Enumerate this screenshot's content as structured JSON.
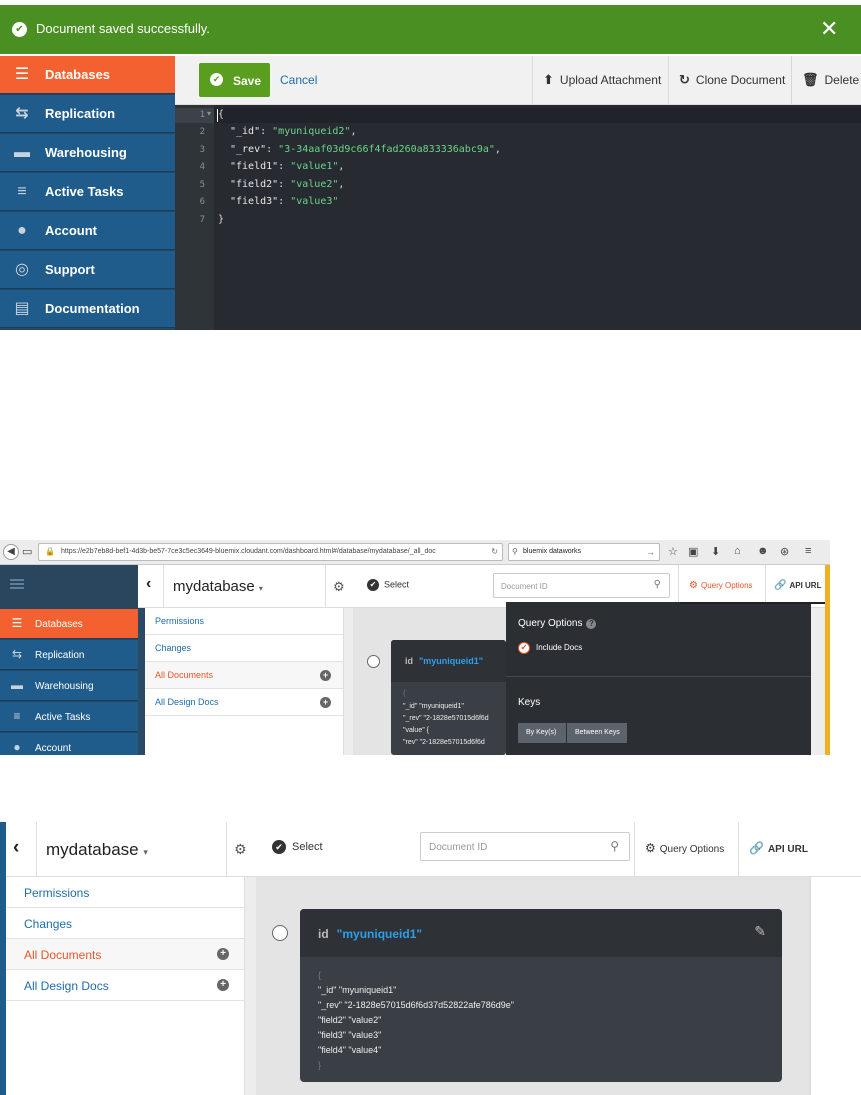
{
  "panel1": {
    "banner": {
      "message": "Document saved successfully.",
      "close": "✕"
    },
    "sidebar": [
      {
        "label": "Databases",
        "icon": "database-icon",
        "active": true
      },
      {
        "label": "Replication",
        "icon": "replication-icon"
      },
      {
        "label": "Warehousing",
        "icon": "warehouse-icon"
      },
      {
        "label": "Active Tasks",
        "icon": "tasks-icon"
      },
      {
        "label": "Account",
        "icon": "user-icon"
      },
      {
        "label": "Support",
        "icon": "lifebuoy-icon"
      },
      {
        "label": "Documentation",
        "icon": "book-icon"
      }
    ],
    "toolbar": {
      "save": "Save",
      "cancel": "Cancel",
      "upload": "Upload Attachment",
      "clone": "Clone Document",
      "delete": "Delete"
    },
    "editor": {
      "line_numbers": [
        "1",
        "2",
        "3",
        "4",
        "5",
        "6",
        "7"
      ],
      "fold_marker": "▾",
      "open_brace": "{",
      "close_brace": "}",
      "fields": [
        {
          "key": "\"_id\"",
          "value": "\"myuniqueid2\""
        },
        {
          "key": "\"_rev\"",
          "value": "\"3-34aaf03d9c66f4fad260a833336abc9a\""
        },
        {
          "key": "\"field1\"",
          "value": "\"value1\""
        },
        {
          "key": "\"field2\"",
          "value": "\"value2\""
        },
        {
          "key": "\"field3\"",
          "value": "\"value3\""
        }
      ]
    }
  },
  "panel2": {
    "browser": {
      "url": "https://e2b7eb8d-bef1-4d3b-be57-7ce3c5ec3649-bluemix.cloudant.com/dashboard.html#/database/mydatabase/_all_doc",
      "search": "bluemix dataworks"
    },
    "sidebar": [
      {
        "label": "Databases",
        "active": true
      },
      {
        "label": "Replication"
      },
      {
        "label": "Warehousing"
      },
      {
        "label": "Active Tasks"
      },
      {
        "label": "Account"
      }
    ],
    "db_name": "mydatabase",
    "menu": [
      "Permissions",
      "Changes",
      "All Documents",
      "All Design Docs"
    ],
    "toolbar": {
      "select": "Select",
      "doc_id_placeholder": "Document ID",
      "query_options": "Query Options",
      "api_url": "API URL"
    },
    "card": {
      "id_label": "id",
      "id_value": "\"myuniqueid1\"",
      "lines": [
        "{",
        "\"_id\" \"myuniqueid1\"",
        "\"_rev\" \"2-1828e57015d6f6d",
        "\"value\" {",
        "  \"rev\" \"2-1828e57015d6f6d"
      ]
    },
    "query_panel": {
      "title": "Query Options",
      "include_docs": "Include Docs",
      "keys": "Keys",
      "by_keys": "By Key(s)",
      "between_keys": "Between Keys"
    }
  },
  "panel3": {
    "db_name": "mydatabase",
    "menu": [
      "Permissions",
      "Changes",
      "All Documents",
      "All Design Docs"
    ],
    "toolbar": {
      "select": "Select",
      "doc_id_placeholder": "Document ID",
      "query_options": "Query Options",
      "api_url": "API URL"
    },
    "card": {
      "id_label": "id",
      "id_value": "\"myuniqueid1\"",
      "lines": [
        "{",
        "\"_id\" \"myuniqueid1\"",
        "\"_rev\" \"2-1828e57015d6f6d37d52822afe786d9e\"",
        "\"field2\" \"value2\"",
        "\"field3\" \"value3\"",
        "\"field4\" \"value4\"",
        "}"
      ]
    }
  }
}
